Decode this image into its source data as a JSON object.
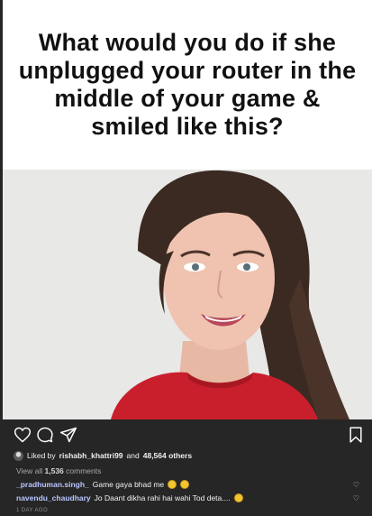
{
  "meme": {
    "caption": "What would you do if she unplugged your router in the middle of your game & smiled like this?"
  },
  "actions": {
    "like_icon": "heart-outline-icon",
    "comment_icon": "comment-bubble-icon",
    "share_icon": "paper-plane-icon",
    "save_icon": "bookmark-icon"
  },
  "likes": {
    "prefix": "Liked by",
    "user": "rishabh_khattri99",
    "middle": "and",
    "others": "48,564 others"
  },
  "comments": {
    "view_all_prefix": "View all",
    "view_all_count": "1,536",
    "view_all_suffix": "comments",
    "items": [
      {
        "user": "_pradhuman.singh_",
        "text": "Game gaya bhad me"
      },
      {
        "user": "navendu_chaudhary",
        "text": "Jo Daant dikha rahi hai wahi Tod deta...."
      }
    ]
  },
  "timestamp": "1 DAY AGO",
  "colors": {
    "background": "#262626",
    "username": "#b9c6ff",
    "muted": "#a8a8a8"
  }
}
